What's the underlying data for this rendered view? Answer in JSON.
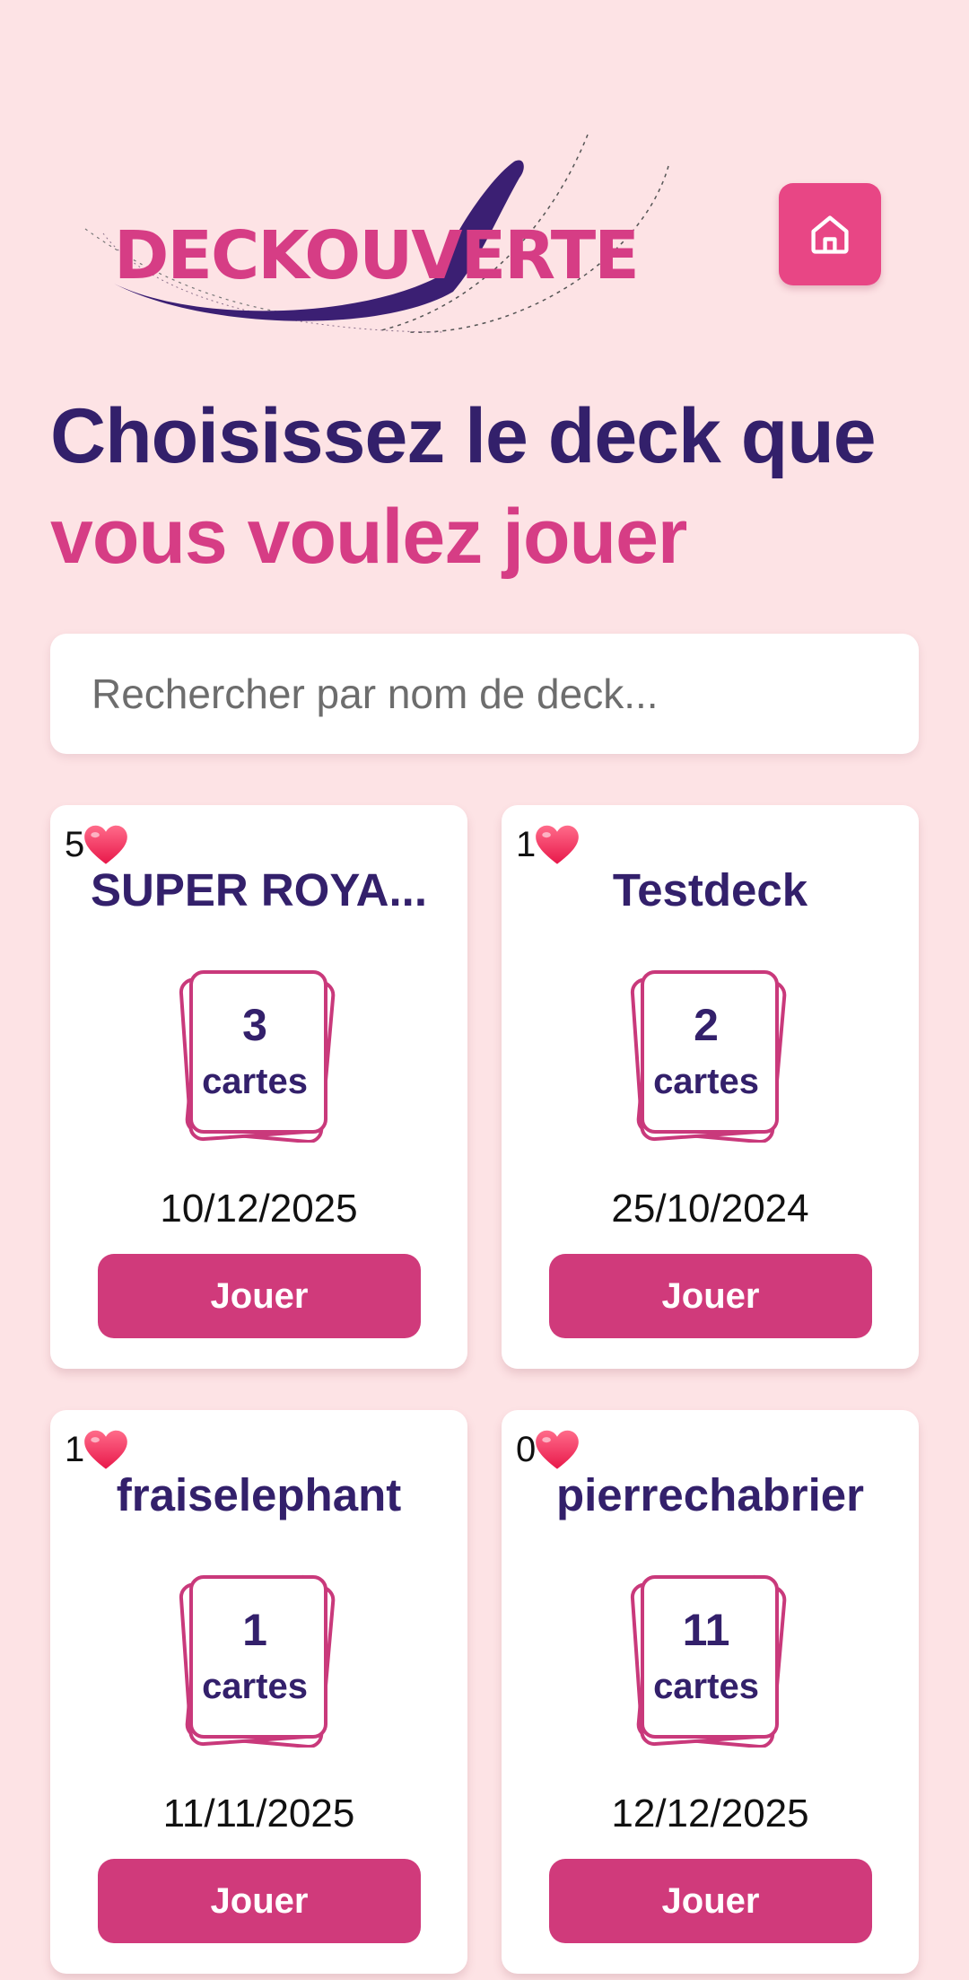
{
  "header": {
    "logo_text": "DECKOUVERTE",
    "home_icon": "home-icon"
  },
  "title": {
    "line1": "Choisissez le deck que",
    "line2": "vous voulez jouer"
  },
  "search": {
    "placeholder": "Rechercher par nom de deck...",
    "value": ""
  },
  "colors": {
    "background": "#fde3e5",
    "accent_pink": "#d63d85",
    "button_pink": "#d03a7b",
    "home_button": "#e84685",
    "navy": "#33206b"
  },
  "decks": [
    {
      "likes": "5",
      "name": "SUPER ROYA...",
      "count": "3",
      "unit": "cartes",
      "date": "10/12/2025",
      "play_label": "Jouer"
    },
    {
      "likes": "1",
      "name": "Testdeck",
      "count": "2",
      "unit": "cartes",
      "date": "25/10/2024",
      "play_label": "Jouer"
    },
    {
      "likes": "1",
      "name": "fraiselephant",
      "count": "1",
      "unit": "cartes",
      "date": "11/11/2025",
      "play_label": "Jouer"
    },
    {
      "likes": "0",
      "name": "pierrechabrier",
      "count": "11",
      "unit": "cartes",
      "date": "12/12/2025",
      "play_label": "Jouer"
    }
  ]
}
